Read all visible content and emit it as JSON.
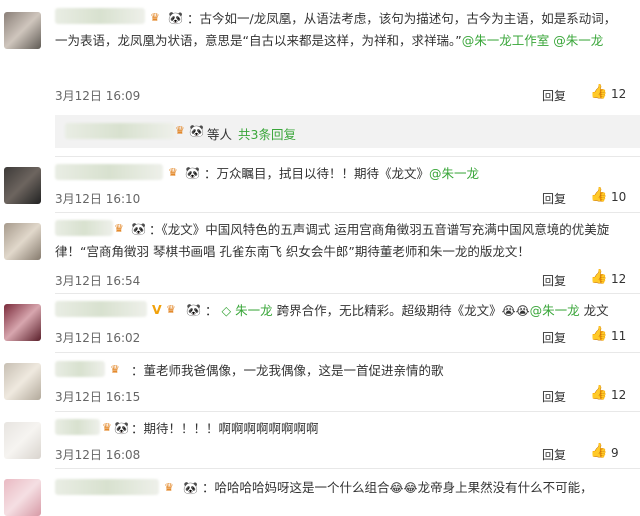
{
  "comments": [
    {
      "text_a": "：古今如一/龙凤凰，从语法考虑，该句为描述句，古今为主语，如是系动词，一为表语，龙凤凰为状语，意思是“自古以来都是这样，为祥和，求祥瑞。”",
      "link1": "@朱一龙工作室",
      "link2": "@朱一龙",
      "time": "3月12日 16:09",
      "reply": "回复",
      "likes": "12"
    },
    {
      "subreply_text": "等人",
      "subreply_link": "共3条回复"
    },
    {
      "text_a": "：万众瞩目，拭目以待！！期待《龙文》",
      "link1": "@朱一龙",
      "time": "3月12日 16:10",
      "reply": "回复",
      "likes": "10"
    },
    {
      "text_a": "：《龙文》中国风特色的五声调式 运用宫商角徵羽五音谱写充满中国风意境的优美旋律！“宫商角徵羽 琴棋书画唱 孔雀东南飞 织女会牛郎”期待董老师和朱一龙的版龙文！",
      "time": "3月12日 16:54",
      "reply": "回复",
      "likes": "12"
    },
    {
      "text_pre": "：",
      "link1": "朱一龙",
      "text_a": "跨界合作，无比精彩。超级期待《龙文》",
      "link2": "@朱一龙",
      "text_b": "龙文",
      "time": "3月12日 16:02",
      "reply": "回复",
      "likes": "11"
    },
    {
      "text_a": "：董老师我爸偶像，一龙我偶像，这是一首促进亲情的歌",
      "time": "3月12日 16:15",
      "reply": "回复",
      "likes": "12"
    },
    {
      "text_a": "：期待！！！！啊啊啊啊啊啊啊啊",
      "time": "3月12日 16:08",
      "reply": "回复",
      "likes": "9"
    },
    {
      "text_a": "：哈哈哈哈妈呀这是一个什么组合",
      "text_b": "龙帝身上果然没有什么不可能，"
    }
  ],
  "colors": {
    "link": "#3aa63a",
    "badge": "#e07b12"
  },
  "icons": {
    "thumb": "thumbs-up-icon",
    "panda": "panda-icon",
    "crown": "crown-badge-icon"
  }
}
